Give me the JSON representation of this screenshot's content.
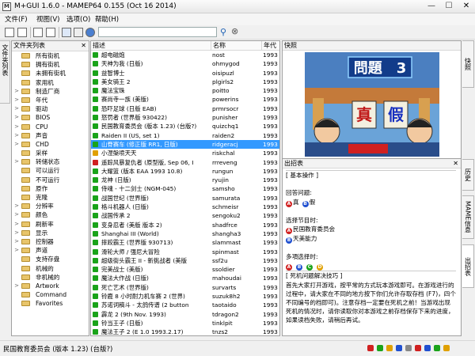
{
  "titlebar": {
    "title": "M+GUI 1.6.0 - MAMEP64 0.155 (Oct 16 2014)",
    "minimize": "—",
    "maximize": "☐",
    "close": "✕"
  },
  "menus": [
    "文件(F)",
    "视图(V)",
    "选项(O)",
    "帮助(H)"
  ],
  "toolbar": {
    "search_value": ""
  },
  "left_tab": "文件夹列表",
  "folders": {
    "title": "文件夹列表",
    "items": [
      {
        "label": "所有街机",
        "exp": ""
      },
      {
        "label": "拥有街机",
        "exp": ""
      },
      {
        "label": "未拥有街机",
        "exp": ""
      },
      {
        "label": "家用机",
        "exp": ""
      },
      {
        "label": "制造厂商",
        "exp": ">"
      },
      {
        "label": "年代",
        "exp": ">"
      },
      {
        "label": "驱动",
        "exp": ">"
      },
      {
        "label": "BIOS",
        "exp": ">"
      },
      {
        "label": "CPU",
        "exp": ">"
      },
      {
        "label": "声音",
        "exp": ">"
      },
      {
        "label": "CHD",
        "exp": ">"
      },
      {
        "label": "采样",
        "exp": ""
      },
      {
        "label": "转储状态",
        "exp": ">"
      },
      {
        "label": "可以运行",
        "exp": ""
      },
      {
        "label": "不可运行",
        "exp": ""
      },
      {
        "label": "原作",
        "exp": ""
      },
      {
        "label": "克隆",
        "exp": ""
      },
      {
        "label": "分辨率",
        "exp": ">"
      },
      {
        "label": "颜色",
        "exp": ">"
      },
      {
        "label": "刷新率",
        "exp": ">"
      },
      {
        "label": "显示",
        "exp": ">"
      },
      {
        "label": "控制器",
        "exp": ">"
      },
      {
        "label": "声道",
        "exp": ">"
      },
      {
        "label": "支持存盘",
        "exp": ""
      },
      {
        "label": "机械的",
        "exp": ""
      },
      {
        "label": "非机械的",
        "exp": ""
      },
      {
        "label": "Artwork",
        "exp": ">"
      },
      {
        "label": "Command",
        "exp": ""
      },
      {
        "label": "Favorites",
        "exp": ""
      }
    ]
  },
  "gamelist": {
    "columns": [
      "描述",
      "名称",
      "年代"
    ],
    "selected_index": 10,
    "rows": [
      {
        "desc": "超电磁炮",
        "name": "nost",
        "year": "1993",
        "c": "#1aa31a"
      },
      {
        "desc": "天神为我 (日版)",
        "name": "ohmygod",
        "year": "1993",
        "c": "#1aa31a"
      },
      {
        "desc": "益智博士",
        "name": "oisipuzl",
        "year": "1993",
        "c": "#1aa31a"
      },
      {
        "desc": "美女骑王 2",
        "name": "plgirls2",
        "year": "1993",
        "c": "#1aa31a"
      },
      {
        "desc": "魔法宝珠",
        "name": "poitto",
        "year": "1993",
        "c": "#1aa31a"
      },
      {
        "desc": "赛尚寺一族 (美版)",
        "name": "powerins",
        "year": "1993",
        "c": "#1aa31a"
      },
      {
        "desc": "恐吓足球 (日版 EAB)",
        "name": "prmrsocr",
        "year": "1993",
        "c": "#1aa31a"
      },
      {
        "desc": "怒罚者 (世界版 930422)",
        "name": "punisher",
        "year": "1993",
        "c": "#1aa31a"
      },
      {
        "desc": "民国教育委员会 (版本 1.23) (台版?)",
        "name": "quizchq1",
        "year": "1993",
        "c": "#1aa31a"
      },
      {
        "desc": "Raiden II (US, set 1)",
        "name": "raiden2",
        "year": "1993",
        "c": "#1aa31a"
      },
      {
        "desc": "山脊赛车 (修正版 RR1, 日版)",
        "name": "ridgeracj",
        "year": "1993",
        "c": "#1aa31a"
      },
      {
        "desc": "小涅槃喷天天",
        "name": "riskchal",
        "year": "1993",
        "c": "#e0a000"
      },
      {
        "desc": "遥踪风暴复仇者 (原型版, Sep 06, I",
        "name": "rrreveng",
        "year": "1993",
        "c": "#d02020"
      },
      {
        "desc": "大耀篮 (版本 EAA 1993 10.8)",
        "name": "rungun",
        "year": "1993",
        "c": "#1aa31a"
      },
      {
        "desc": "龙神 (日版)",
        "name": "ryujin",
        "year": "1993",
        "c": "#1aa31a"
      },
      {
        "desc": "侍魂 - 十二剑士 (NGM-045)",
        "name": "samsho",
        "year": "1993",
        "c": "#1aa31a"
      },
      {
        "desc": "战国世纪 (世界版)",
        "name": "samurata",
        "year": "1993",
        "c": "#1aa31a"
      },
      {
        "desc": "格斗机器人 (日版)",
        "name": "schmeisr",
        "year": "1993",
        "c": "#1aa31a"
      },
      {
        "desc": "战国传承 2",
        "name": "sengoku2",
        "year": "1993",
        "c": "#1aa31a"
      },
      {
        "desc": "变身忍者 (美版 版本 2)",
        "name": "shadfrce",
        "year": "1993",
        "c": "#1aa31a"
      },
      {
        "desc": "Shanghai III (World)",
        "name": "shangha3",
        "year": "1993",
        "c": "#1aa31a"
      },
      {
        "desc": "摔跤霸王 (世界版 930713)",
        "name": "slammast",
        "year": "1993",
        "c": "#1aa31a"
      },
      {
        "desc": "滑轮大师 / 强尼大冒险",
        "name": "spinmast",
        "year": "1993",
        "c": "#1aa31a"
      },
      {
        "desc": "超级街头霸王 II - 新挑战者 (美版",
        "name": "ssf2u",
        "year": "1993",
        "c": "#1aa31a"
      },
      {
        "desc": "完美战士 (美版)",
        "name": "ssoldier",
        "year": "1993",
        "c": "#1aa31a"
      },
      {
        "desc": "魔法大作战 (日版)",
        "name": "mahoudai",
        "year": "1993",
        "c": "#1aa31a"
      },
      {
        "desc": "死亡艺术 (世界版)",
        "name": "survarts",
        "year": "1993",
        "c": "#1aa31a"
      },
      {
        "desc": "铃鹿 8 小时耐力机车赛 2 (世界)",
        "name": "suzuk8h2",
        "year": "1993",
        "c": "#1aa31a"
      },
      {
        "desc": "苏诺词稿斗 - 太鸽传谱 (2 button",
        "name": "taotaido",
        "year": "1993",
        "c": "#1aa31a"
      },
      {
        "desc": "霹龙 2 (9th Nov. 1993)",
        "name": "tdragon2",
        "year": "1993",
        "c": "#1aa31a"
      },
      {
        "desc": "铃当王子 (日版)",
        "name": "tinklpit",
        "year": "1993",
        "c": "#1aa31a"
      },
      {
        "desc": "魔法王子 2 (E 1.0 1993.2.17)",
        "name": "tnzs2",
        "year": "1993",
        "c": "#1aa31a"
      }
    ]
  },
  "snapshot": {
    "title": "快照",
    "screen_text": "問題　3",
    "button_left": "真",
    "button_right": "假"
  },
  "cheat": {
    "title": "出招表",
    "lines": [
      {
        "t": "[ 基本操作 ]",
        "bar": true
      },
      {
        "t": "",
        "blank": true
      },
      {
        "t": "回答问题:"
      },
      {
        "t": "真 假",
        "circles": [
          [
            "A",
            "#d02020",
            "真"
          ],
          [
            "B",
            "#2050d0",
            "假"
          ]
        ]
      },
      {
        "t": "",
        "blank": true
      },
      {
        "t": "选择节目时:"
      },
      {
        "t": "民国教育委员会",
        "circles": [
          [
            "A",
            "#d02020",
            "民国教育委员会"
          ]
        ]
      },
      {
        "t": "天美能力",
        "circles": [
          [
            "B",
            "#2050d0",
            "天美能力"
          ]
        ]
      },
      {
        "t": "",
        "blank": true
      },
      {
        "t": "多項选择时:"
      },
      {
        "t": "",
        "circles": [
          [
            "A",
            "#d02020",
            ""
          ],
          [
            "B",
            "#2050d0",
            ""
          ],
          [
            "C",
            "#1aa31a",
            ""
          ],
          [
            "D",
            "#e0a000",
            ""
          ]
        ]
      },
      {
        "t": "[ 死机问题解决技巧 ]",
        "bar": true
      }
    ],
    "paragraph": "首先大家打开游戏，按平常的方式玩本游戏即可。在游戏进行的过程中，请大家在不同的地方按下你们允许存取存档 (F7)，四个不同编号的档即可)。注意存档一定要在死机之前！当游戏出现死机的情况时，请你读取你对本游戏之前存档保存下来的进度，如果读档失败，请稍后再试。"
  },
  "right_tabs": [
    "快照",
    "历史",
    "MAME信息",
    "出招表"
  ],
  "status": {
    "text": "民国教育委员会 (版本 1.23) (台版?)"
  },
  "colors": {
    "selection": "#3399ff",
    "available": "#1aa31a",
    "warning": "#e0a000",
    "broken": "#d02020"
  }
}
